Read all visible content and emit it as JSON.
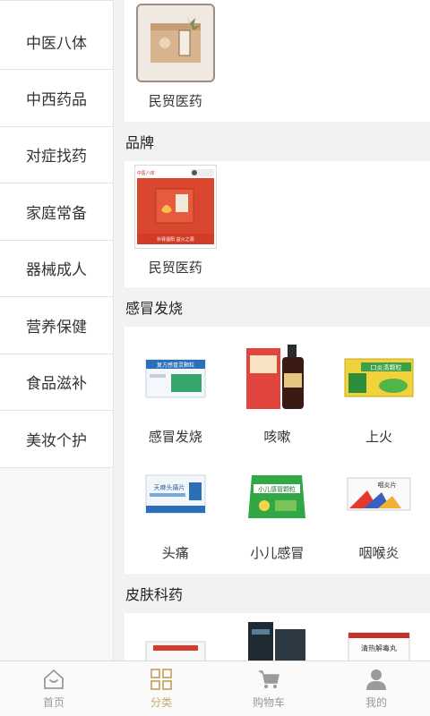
{
  "sidebar": {
    "items": [
      {
        "label": "中医八体"
      },
      {
        "label": "中西药品"
      },
      {
        "label": "对症找药"
      },
      {
        "label": "家庭常备"
      },
      {
        "label": "器械成人"
      },
      {
        "label": "营养保健"
      },
      {
        "label": "食品滋补"
      },
      {
        "label": "美妆个护"
      }
    ]
  },
  "top_item": {
    "label": "民贸医药"
  },
  "sections": {
    "brand": {
      "title": "品牌",
      "item_label": "民贸医药",
      "badge_left": "中医八体",
      "badge_bottom": "补肾温阳 益火之源"
    },
    "cold": {
      "title": "感冒发烧",
      "items": [
        {
          "label": "感冒发烧",
          "product": "复方感冒灵颗粒"
        },
        {
          "label": "咳嗽"
        },
        {
          "label": "上火",
          "product": "口炎清颗粒"
        },
        {
          "label": "头痛",
          "product": "天麻头痛片"
        },
        {
          "label": "小儿感冒",
          "product": "小儿感冒颗粒"
        },
        {
          "label": "咽喉炎",
          "product": "咽炎片"
        }
      ]
    },
    "skin": {
      "title": "皮肤科药",
      "product_right": "清热解毒丸"
    }
  },
  "tabbar": {
    "items": [
      {
        "label": "首页"
      },
      {
        "label": "分类"
      },
      {
        "label": "购物车"
      },
      {
        "label": "我的"
      }
    ],
    "active_color": "#c9a76a",
    "inactive_color": "#999999"
  }
}
